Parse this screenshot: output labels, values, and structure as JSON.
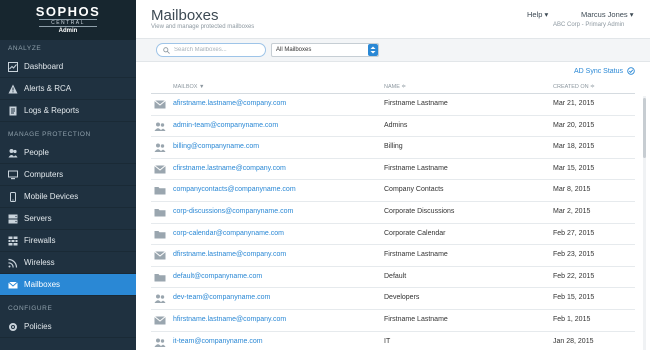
{
  "brand": {
    "logo": "SOPHOS",
    "central": "CENTRAL",
    "admin": "Admin"
  },
  "sidebar": {
    "sections": [
      {
        "title": "ANALYZE",
        "items": [
          {
            "label": "Dashboard",
            "icon": "dashboard-icon"
          },
          {
            "label": "Alerts & RCA",
            "icon": "alert-icon"
          },
          {
            "label": "Logs & Reports",
            "icon": "document-icon"
          }
        ]
      },
      {
        "title": "MANAGE PROTECTION",
        "items": [
          {
            "label": "People",
            "icon": "people-icon"
          },
          {
            "label": "Computers",
            "icon": "computer-icon"
          },
          {
            "label": "Mobile Devices",
            "icon": "mobile-icon"
          },
          {
            "label": "Servers",
            "icon": "server-icon"
          },
          {
            "label": "Firewalls",
            "icon": "firewall-icon"
          },
          {
            "label": "Wireless",
            "icon": "wireless-icon"
          },
          {
            "label": "Mailboxes",
            "icon": "mail-icon",
            "active": true
          }
        ]
      },
      {
        "title": "CONFIGURE",
        "items": [
          {
            "label": "Policies",
            "icon": "policies-icon"
          }
        ]
      }
    ]
  },
  "header": {
    "title": "Mailboxes",
    "subtitle": "View and manage protected mailboxes",
    "help": "Help",
    "user": "Marcus Jones",
    "org": "ABC Corp - Primary Admin"
  },
  "toolbar": {
    "search_placeholder": "Search Mailboxes...",
    "filter_value": "All Mailboxes"
  },
  "ad_sync_label": "AD Sync Status",
  "table": {
    "columns": {
      "mailbox": "MAILBOX ▼",
      "name": "NAME ≑",
      "created": "CREATED ON ≑"
    },
    "rows": [
      {
        "type": "user",
        "email": "afirstname.lastname@company.com",
        "name": "Firstname Lastname",
        "created": "Mar 21, 2015"
      },
      {
        "type": "group",
        "email": "admin-team@companyname.com",
        "name": "Admins",
        "created": "Mar 20, 2015"
      },
      {
        "type": "group",
        "email": "billing@companyname.com",
        "name": "Billing",
        "created": "Mar 18, 2015"
      },
      {
        "type": "user",
        "email": "cfirstname.lastname@company.com",
        "name": "Firstname Lastname",
        "created": "Mar 15, 2015"
      },
      {
        "type": "folder",
        "email": "companycontacts@companyname.com",
        "name": "Company Contacts",
        "created": "Mar 8, 2015"
      },
      {
        "type": "folder",
        "email": "corp-discussions@companyname.com",
        "name": "Corporate Discussions",
        "created": "Mar 2, 2015"
      },
      {
        "type": "folder",
        "email": "corp-calendar@companyname.com",
        "name": "Corporate Calendar",
        "created": "Feb 27, 2015"
      },
      {
        "type": "user",
        "email": "dfirstname.lastname@company.com",
        "name": "Firstname Lastname",
        "created": "Feb 23, 2015"
      },
      {
        "type": "folder",
        "email": "default@companyname.com",
        "name": "Default",
        "created": "Feb 22, 2015"
      },
      {
        "type": "group",
        "email": "dev-team@companyname.com",
        "name": "Developers",
        "created": "Feb 15, 2015"
      },
      {
        "type": "user",
        "email": "hfirstname.lastname@company.com",
        "name": "Firstname Lastname",
        "created": "Feb 1, 2015"
      },
      {
        "type": "group",
        "email": "it-team@companyname.com",
        "name": "IT",
        "created": "Jan 28, 2015"
      }
    ]
  },
  "colors": {
    "sidebar": "#1f3140",
    "accent": "#2a88d5"
  }
}
